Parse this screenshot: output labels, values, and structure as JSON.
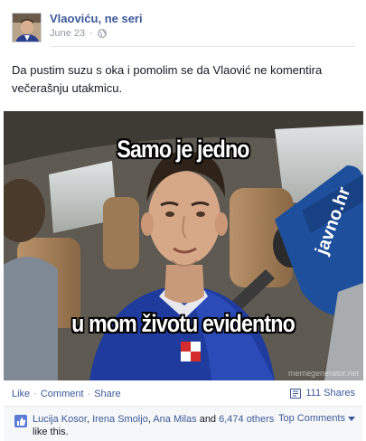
{
  "post": {
    "page_name": "Vlaoviću, ne seri",
    "date": "June 23",
    "text": "Da pustim suzu s oka i pomolim se da Vlaović ne komentira večerašnju utakmicu.",
    "privacy_icon": "globe-icon"
  },
  "meme": {
    "caption_top": "Samo je jedno",
    "caption_bottom": "u mom životu evidentno",
    "mic_text": "javno.hr",
    "watermark": "memegenerator.net"
  },
  "actions": {
    "like": "Like",
    "comment": "Comment",
    "share": "Share",
    "separator": "·",
    "shares_count": "111 Shares"
  },
  "likes": {
    "names": [
      "Lucija Kosor",
      "Irena Smoljo",
      "Ana Milas"
    ],
    "comma": ", ",
    "and": " and ",
    "others": "6,474 others",
    "suffix": " like this.",
    "top_comments": "Top Comments",
    "dropdown_icon": "caret-down-icon"
  },
  "colors": {
    "link": "#3b5998",
    "meta": "#9197a3",
    "text": "#141823",
    "likes_bg": "#f6f7f8"
  }
}
